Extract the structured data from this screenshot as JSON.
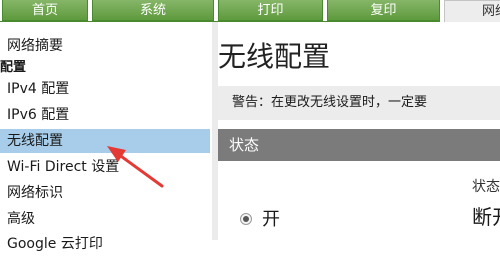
{
  "tabs": [
    {
      "label": "首页",
      "active": false
    },
    {
      "label": "系统",
      "active": false
    },
    {
      "label": "打印",
      "active": false
    },
    {
      "label": "复印",
      "active": false
    },
    {
      "label": "网络",
      "active": true
    }
  ],
  "sidebar": {
    "items": [
      {
        "label": "网络摘要",
        "type": "link"
      },
      {
        "label": "配置",
        "type": "header"
      },
      {
        "label": "IPv4 配置",
        "type": "link"
      },
      {
        "label": "IPv6 配置",
        "type": "link"
      },
      {
        "label": "无线配置",
        "type": "link",
        "selected": true
      },
      {
        "label": "Wi-Fi Direct 设置",
        "type": "link"
      },
      {
        "label": "网络标识",
        "type": "link"
      },
      {
        "label": "高级",
        "type": "link"
      },
      {
        "label": "Google 云打印",
        "type": "link"
      }
    ]
  },
  "main": {
    "title": "无线配置",
    "warning": "警告：在更改无线设置时，一定要",
    "status_section": "状态",
    "status_label": "状态",
    "radio_on_label": "开",
    "status_value": "断开",
    "info_icon_glyph": "i"
  },
  "colors": {
    "tab_green": "#6aa84f",
    "selected_item": "#a7cdea",
    "status_bar": "#7b7b7b",
    "annotation_arrow": "#e53935"
  }
}
